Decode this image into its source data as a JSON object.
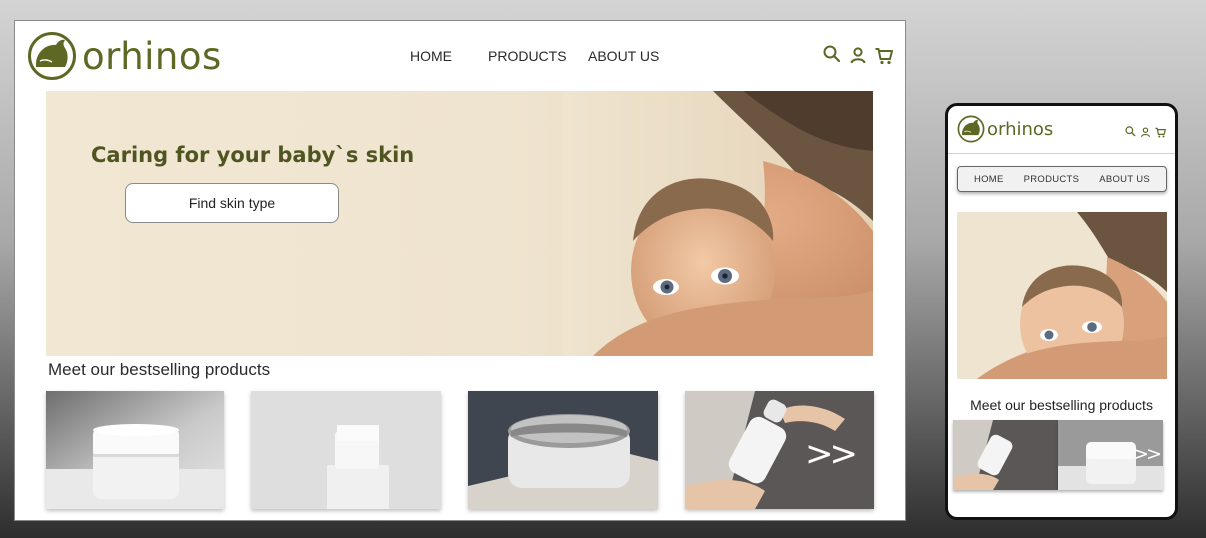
{
  "brand": {
    "name": "orhinos",
    "color": "#5e6724"
  },
  "nav": {
    "home": "HOME",
    "products": "PRODUCTS",
    "about": "ABOUT US"
  },
  "header_icons": [
    "search-icon",
    "user-icon",
    "cart-icon"
  ],
  "hero": {
    "title": "Caring for your baby`s skin",
    "button_label": "Find skin type"
  },
  "bestsellers": {
    "title": "Meet our bestselling products",
    "next_arrow": ">>",
    "products": [
      {
        "name": "cream-jar"
      },
      {
        "name": "pump-bottle"
      },
      {
        "name": "metal-tin"
      },
      {
        "name": "bottle-in-hands"
      }
    ]
  },
  "colors": {
    "accent": "#5e6724",
    "hero_bg": "#f1e7d3",
    "text_dark": "#4f5521"
  }
}
